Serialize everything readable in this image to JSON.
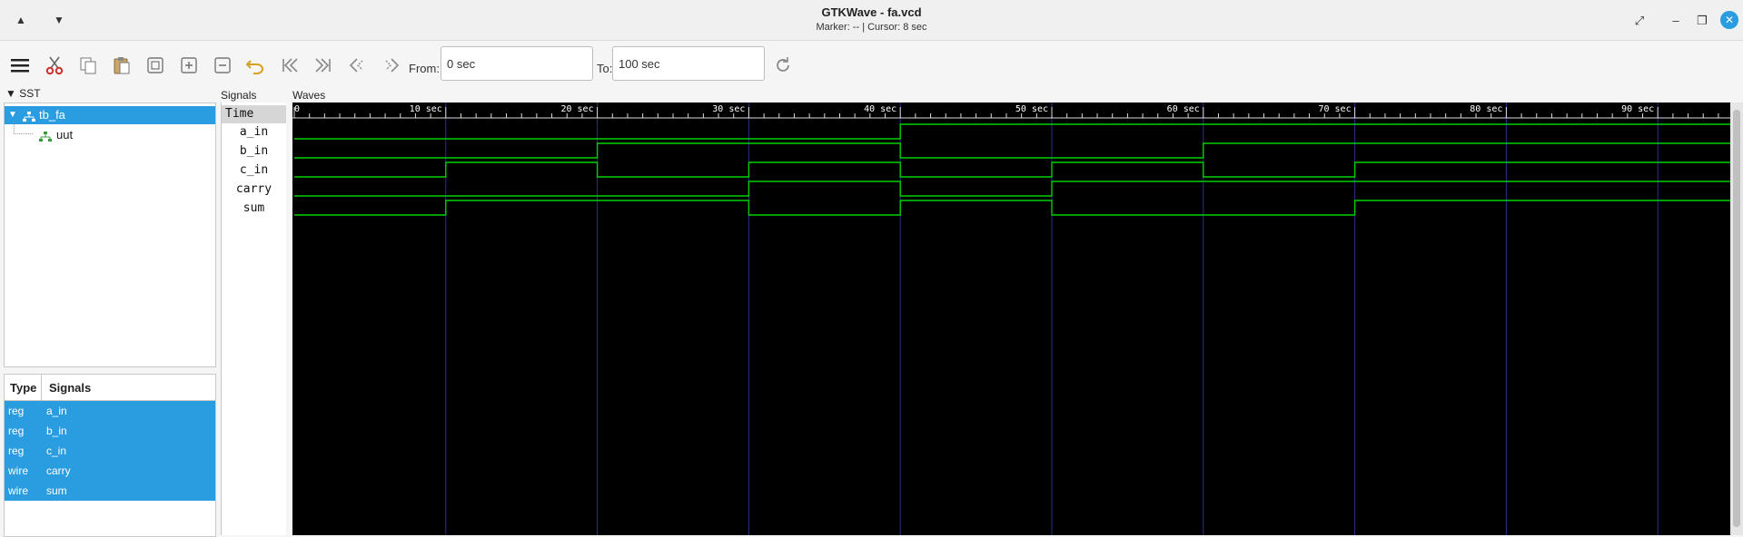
{
  "window": {
    "title": "GTKWave - fa.vcd",
    "subtitle": "Marker: --  |  Cursor: 8 sec"
  },
  "toolbar": {
    "from_label": "From:",
    "from_value": "0 sec",
    "to_label": "To:",
    "to_value": "100 sec",
    "icons": [
      "menu-icon",
      "cut-icon",
      "copy-icon",
      "paste-icon",
      "zoom-fit-icon",
      "zoom-in-icon",
      "zoom-out-icon",
      "undo-icon",
      "first-icon",
      "last-icon",
      "prev-icon",
      "next-icon",
      "reload-icon"
    ]
  },
  "sst": {
    "label": "SST",
    "tree": [
      {
        "label": "tb_fa",
        "selected": true
      },
      {
        "label": "uut",
        "selected": false
      }
    ]
  },
  "signal_table": {
    "headers": [
      "Type",
      "Signals"
    ],
    "rows": [
      {
        "type": "reg",
        "name": "a_in"
      },
      {
        "type": "reg",
        "name": "b_in"
      },
      {
        "type": "reg",
        "name": "c_in"
      },
      {
        "type": "wire",
        "name": "carry"
      },
      {
        "type": "wire",
        "name": "sum"
      }
    ]
  },
  "signals_panel": {
    "label": "Signals",
    "time_label": "Time",
    "names": [
      "a_in",
      "b_in",
      "c_in",
      "carry",
      "sum"
    ]
  },
  "waves_panel": {
    "label": "Waves",
    "tick_labels": [
      "0",
      "10 sec",
      "20 sec",
      "30 sec",
      "40 sec",
      "50 sec",
      "60 sec",
      "70 sec",
      "80 sec",
      "90 sec"
    ],
    "range_sec": [
      0,
      95
    ],
    "signals": [
      {
        "name": "a_in",
        "values": [
          0,
          0,
          0,
          0,
          1,
          1,
          1,
          1,
          1,
          1
        ]
      },
      {
        "name": "b_in",
        "values": [
          0,
          0,
          1,
          1,
          0,
          0,
          1,
          1,
          1,
          1
        ]
      },
      {
        "name": "c_in",
        "values": [
          0,
          1,
          0,
          1,
          0,
          1,
          0,
          1,
          1,
          1
        ]
      },
      {
        "name": "carry",
        "values": [
          0,
          0,
          0,
          1,
          0,
          1,
          1,
          1,
          1,
          1
        ]
      },
      {
        "name": "sum",
        "values": [
          0,
          1,
          1,
          0,
          1,
          0,
          0,
          1,
          1,
          1
        ]
      }
    ],
    "colors": {
      "wave": "#00d000",
      "grid": "#2e2e8c",
      "tick": "#dddddd",
      "background": "#000000"
    }
  }
}
